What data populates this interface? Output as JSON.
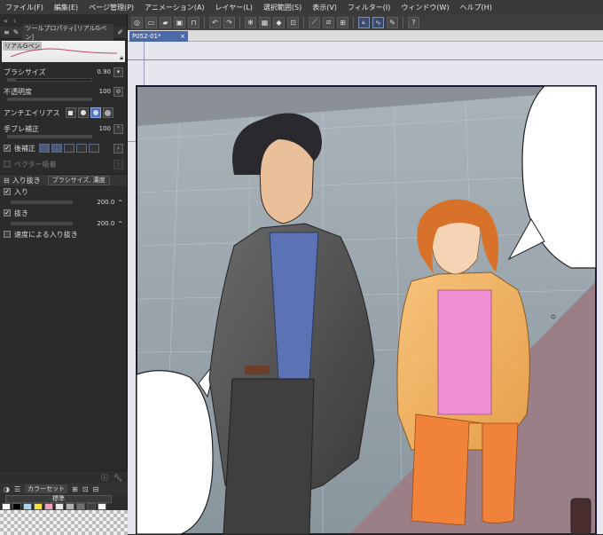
{
  "menu": [
    "ファイル(F)",
    "編集(E)",
    "ページ管理(P)",
    "アニメーション(A)",
    "レイヤー(L)",
    "選択範囲(S)",
    "表示(V)",
    "フィルター(I)",
    "ウィンドウ(W)",
    "ヘルプ(H)"
  ],
  "document": {
    "tab_label": "P052-01*"
  },
  "tool_panel": {
    "title": "ツールプロパティ[リアルGペン]",
    "preset_label": "リアルGペン",
    "brush_size": {
      "label": "ブラシサイズ",
      "value": "0.90"
    },
    "opacity": {
      "label": "不透明度",
      "value": "100"
    },
    "antialias": {
      "label": "アンチエイリアス"
    },
    "stabilization": {
      "label": "手ブレ補正",
      "value": "100"
    },
    "post_correction": {
      "label": "後補正"
    },
    "vector_snap": {
      "label": "ベクター吸着"
    },
    "taper": {
      "label": "入り抜き",
      "mode": "ブラシサイズ, 濃度",
      "start": {
        "label": "入り",
        "value": "200.0"
      },
      "end": {
        "label": "抜き",
        "value": "200.0"
      },
      "speed": {
        "label": "速度による入り抜き"
      }
    }
  },
  "bottom_dock": {
    "tab_label": "カラーセット",
    "set_name": "標準"
  },
  "colors": {
    "accent": "#4f73b8",
    "panel_bg": "#2b2b2b",
    "frame_border": "#1a1a33"
  },
  "swatch_colors": [
    "#ffffff",
    "#000000",
    "#a8d0f0",
    "#f0e040",
    "#f0a0c0",
    "#e8e8e8",
    "#b0b0b0",
    "#707070",
    "#404040",
    "#f8f8f8"
  ]
}
